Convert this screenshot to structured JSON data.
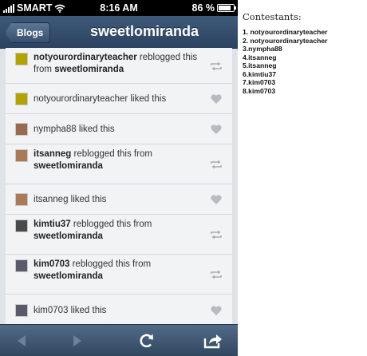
{
  "status_bar": {
    "carrier": "SMART",
    "time": "8:16 AM",
    "battery": "86 %",
    "battery_level": 0.86
  },
  "nav": {
    "back_label": "Blogs",
    "title": "sweetlomiranda"
  },
  "feed": [
    {
      "user": "notyourordinaryteacher",
      "action": " reblogged this from ",
      "source": "sweetlomiranda",
      "type": "reblog",
      "avatar_color": "#b2a400"
    },
    {
      "user": "",
      "action": "notyourordinaryteacher liked this",
      "source": "",
      "type": "like",
      "avatar_color": "#b2a400"
    },
    {
      "user": "",
      "action": "nympha88 liked this",
      "source": "",
      "type": "like",
      "avatar_color": "#9a6a50"
    },
    {
      "user": "itsanneg",
      "action": " reblogged this from ",
      "source": "sweetlomiranda",
      "type": "reblog",
      "avatar_color": "#a87a55"
    },
    {
      "user": "",
      "action": "itsanneg liked this",
      "source": "",
      "type": "like",
      "avatar_color": "#a87a55"
    },
    {
      "user": "kimtiu37",
      "action": " reblogged this from ",
      "source": "sweetlomiranda",
      "type": "reblog",
      "avatar_color": "#4a4a4a"
    },
    {
      "user": "kim0703",
      "action": " reblogged this from ",
      "source": "sweetlomiranda",
      "type": "reblog",
      "avatar_color": "#5a5a6a"
    },
    {
      "user": "",
      "action": "kim0703 liked this",
      "source": "",
      "type": "like",
      "avatar_color": "#5a5a6a"
    }
  ],
  "toolbar": {
    "back_icon": "back-arrow-icon",
    "forward_icon": "forward-arrow-icon",
    "refresh_icon": "refresh-icon",
    "share_icon": "share-icon"
  },
  "contestants": {
    "heading": "Contestants:",
    "items": [
      "1. notyourordinaryteacher",
      "2. notyourordinaryteacher",
      "3.nympha88",
      "4.itsanneg",
      "5.itsanneg",
      "6.kimtiu37",
      "7.kim0703",
      "8.kim0703"
    ]
  }
}
